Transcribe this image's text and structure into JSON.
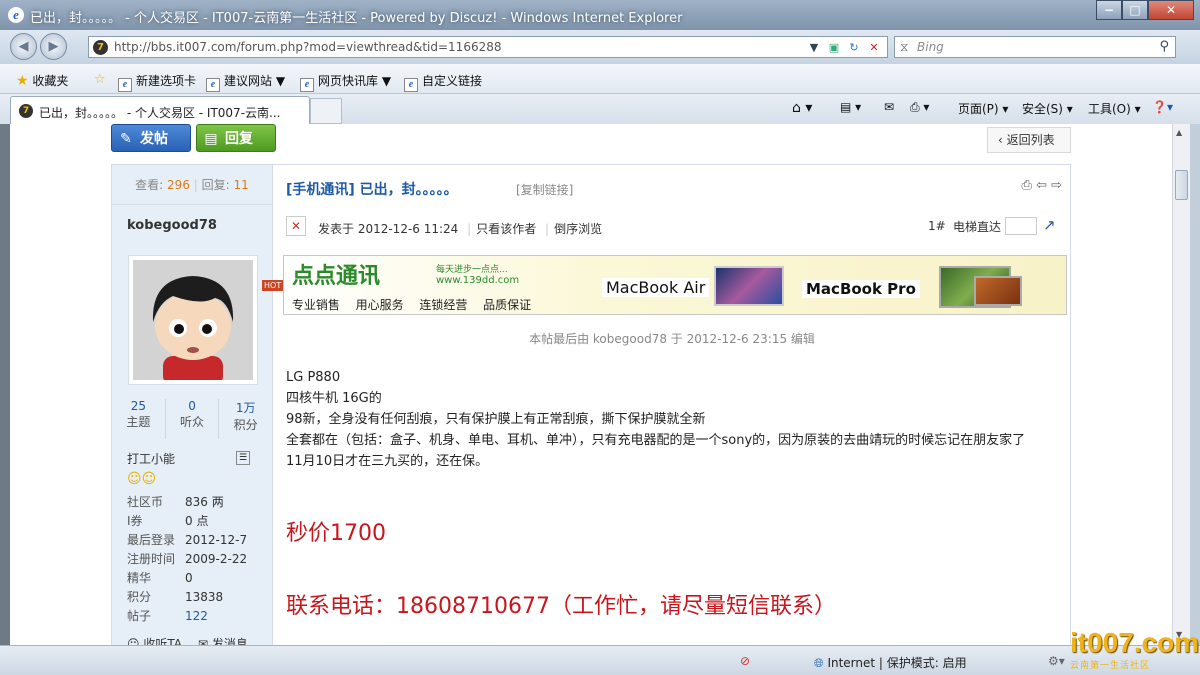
{
  "window": {
    "title": "已出，封。。。。。 - 个人交易区 - IT007-云南第一生活社区 - Powered by Discuz! - Windows Internet Explorer",
    "min": "−",
    "max": "□",
    "close": "✕"
  },
  "nav": {
    "url": "http://bbs.it007.com/forum.php?mod=viewthread&tid=1166288",
    "search_placeholder": "Bing"
  },
  "favbar": {
    "favorites": "收藏夹",
    "items": [
      "新建选项卡",
      "建议网站",
      "网页快讯库",
      "自定义链接"
    ]
  },
  "tab": {
    "title": "已出，封。。。。。 - 个人交易区 - IT007-云南..."
  },
  "commands": {
    "page": "页面(P)",
    "safety": "安全(S)",
    "tools": "工具(O)"
  },
  "page": {
    "post_button": "发帖",
    "reply_button": "回复",
    "back_to_list": "返回列表",
    "views_label": "查看:",
    "views": "296",
    "replies_label": "回复:",
    "replies": "11",
    "thread_title": "[手机通讯] 已出，封。。。。。",
    "copy_link": "[复制链接]",
    "author": "kobegood78",
    "stats": [
      {
        "value": "25",
        "label": "主题"
      },
      {
        "value": "0",
        "label": "听众"
      },
      {
        "value": "1万",
        "label": "积分"
      }
    ],
    "user_title": "打工小能",
    "profile": [
      {
        "k": "社区币",
        "v": "836 两"
      },
      {
        "k": "I券",
        "v": "0 点"
      },
      {
        "k": "最后登录",
        "v": "2012-12-7"
      },
      {
        "k": "注册时间",
        "v": "2009-2-22"
      },
      {
        "k": "精华",
        "v": "0"
      },
      {
        "k": "积分",
        "v": "13838"
      },
      {
        "k": "帖子",
        "v": "122"
      }
    ],
    "follow_ta": "收听TA",
    "send_msg": "发消息",
    "posted_at": "发表于 2012-12-6 11:24",
    "only_author": "只看该作者",
    "reverse": "倒序浏览",
    "floor": "1#",
    "elevator": "电梯直达",
    "banner": {
      "brand": "点点通讯",
      "slogan": "每天进步一点点...",
      "site": "www.139dd.com",
      "tags": [
        "专业销售",
        "用心服务",
        "连锁经营",
        "品质保证"
      ],
      "prod1": "MacBook Air",
      "prod2": "MacBook Pro",
      "hot": "HOT"
    },
    "edited_note": "本帖最后由 kobegood78 于 2012-12-6 23:15 编辑",
    "body_lines": [
      "LG P880",
      "四核牛机  16G的",
      "98新，全身没有任何刮痕，只有保护膜上有正常刮痕，撕下保护膜就全新",
      "全套都在（包括：盒子、机身、单电、耳机、单冲），只有充电器配的是一个sony的，因为原装的去曲靖玩的时候忘记在朋友家了",
      "11月10日才在三九买的，还在保。"
    ],
    "price": "秒价1700",
    "contact": "联系电话：18608710677（工作忙，请尽量短信联系）"
  },
  "status": {
    "zone": "Internet | 保护模式: 启用"
  },
  "watermark": {
    "logo": "it007.com",
    "sub": "云南第一生活社区"
  },
  "colors": {
    "title_blue": "#1e5aa8",
    "price_red": "#c8161d",
    "orange": "#e07a14"
  }
}
